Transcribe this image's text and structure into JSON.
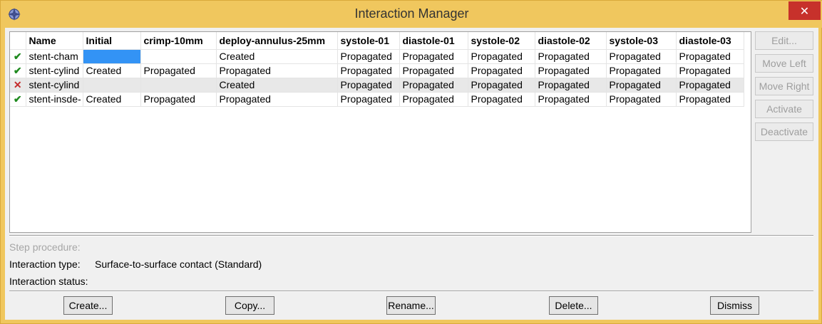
{
  "window": {
    "title": "Interaction Manager",
    "close_glyph": "✕",
    "app_icon": "abaqus-compass-icon"
  },
  "grid": {
    "columns": [
      "",
      "Name",
      "Initial",
      "crimp-10mm",
      "deploy-annulus-25mm",
      "systole-01",
      "diastole-01",
      "systole-02",
      "diastole-02",
      "systole-03",
      "diastole-03"
    ],
    "rows": [
      {
        "status": "✔",
        "status_kind": "ok",
        "cells": [
          "stent-cham",
          "",
          "",
          "Created",
          "Propagated",
          "Propagated",
          "Propagated",
          "Propagated",
          "Propagated",
          "Propagated"
        ]
      },
      {
        "status": "✔",
        "status_kind": "ok",
        "cells": [
          "stent-cylind",
          "Created",
          "Propagated",
          "Propagated",
          "Propagated",
          "Propagated",
          "Propagated",
          "Propagated",
          "Propagated",
          "Propagated"
        ]
      },
      {
        "status": "✕",
        "status_kind": "bad",
        "cells": [
          "stent-cylind",
          "",
          "",
          "Created",
          "Propagated",
          "Propagated",
          "Propagated",
          "Propagated",
          "Propagated",
          "Propagated"
        ]
      },
      {
        "status": "✔",
        "status_kind": "ok",
        "cells": [
          "stent-insde-",
          "Created",
          "Propagated",
          "Propagated",
          "Propagated",
          "Propagated",
          "Propagated",
          "Propagated",
          "Propagated",
          "Propagated"
        ]
      }
    ]
  },
  "side_buttons": {
    "edit": "Edit...",
    "move_left": "Move Left",
    "move_right": "Move Right",
    "activate": "Activate",
    "deactivate": "Deactivate"
  },
  "info": {
    "step_procedure_label": "Step procedure:",
    "interaction_type_label": "Interaction type:",
    "interaction_type_value": "Surface-to-surface contact (Standard)",
    "interaction_status_label": "Interaction status:"
  },
  "bottom_buttons": {
    "create": "Create...",
    "copy": "Copy...",
    "rename": "Rename...",
    "delete": "Delete...",
    "dismiss": "Dismiss"
  }
}
